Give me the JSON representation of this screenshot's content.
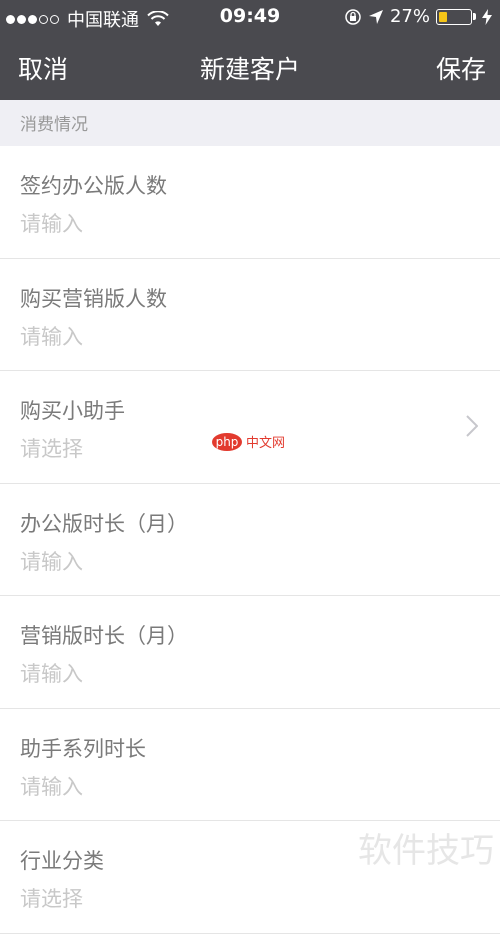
{
  "status_bar": {
    "carrier": "中国联通",
    "time": "09:49",
    "battery_percent": "27%",
    "battery_level": 0.27,
    "battery_color": "#f5c518"
  },
  "nav": {
    "cancel_label": "取消",
    "title": "新建客户",
    "save_label": "保存"
  },
  "section": {
    "title": "消费情况"
  },
  "rows": [
    {
      "label": "签约办公版人数",
      "value": "请输入"
    },
    {
      "label": "购买营销版人数",
      "value": "请输入"
    },
    {
      "label": "购买小助手",
      "value": "请选择"
    },
    {
      "label": "办公版时长（月）",
      "value": "请输入"
    },
    {
      "label": "营销版时长（月）",
      "value": "请输入"
    },
    {
      "label": "助手系列时长",
      "value": "请输入"
    },
    {
      "label": "行业分类",
      "value": "请选择"
    }
  ],
  "watermark": {
    "php_badge": "php",
    "php_text": "中文网",
    "bottom_text": "软件技巧"
  },
  "colors": {
    "header_bg": "#4a4a4f",
    "section_bg": "#efeff4",
    "label": "#7a7a7a",
    "placeholder": "#c8c8c8"
  }
}
